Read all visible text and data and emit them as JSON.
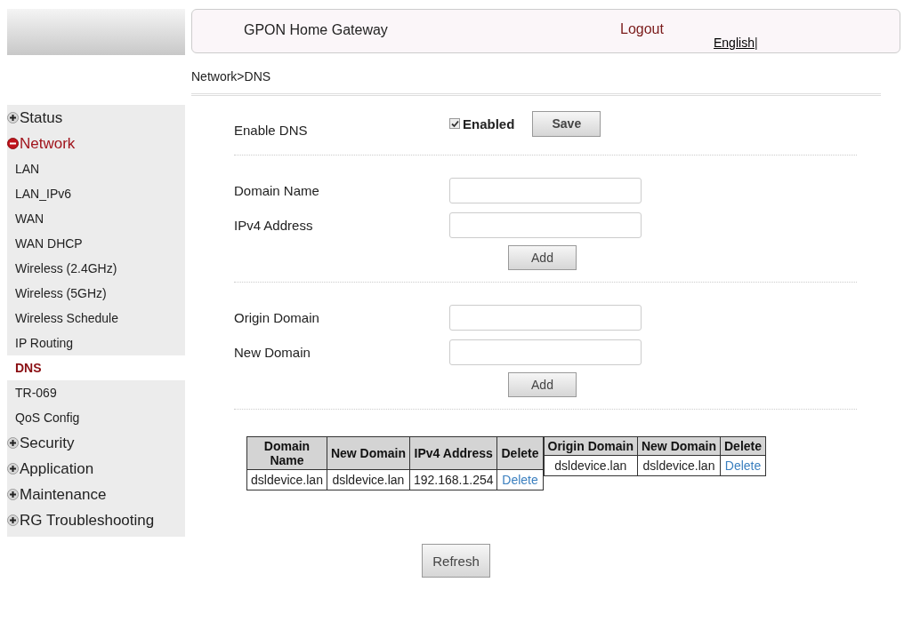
{
  "header": {
    "title": "GPON Home Gateway",
    "logout": "Logout",
    "language": "English",
    "separator": "|"
  },
  "breadcrumb": "Network>DNS",
  "sidebar": {
    "items": [
      {
        "label": "Status",
        "expanded": false
      },
      {
        "label": "Network",
        "expanded": true,
        "children": [
          {
            "label": "LAN",
            "selected": false
          },
          {
            "label": "LAN_IPv6",
            "selected": false
          },
          {
            "label": "WAN",
            "selected": false
          },
          {
            "label": "WAN DHCP",
            "selected": false
          },
          {
            "label": "Wireless (2.4GHz)",
            "selected": false
          },
          {
            "label": "Wireless (5GHz)",
            "selected": false
          },
          {
            "label": "Wireless Schedule",
            "selected": false
          },
          {
            "label": "IP Routing",
            "selected": false
          },
          {
            "label": "DNS",
            "selected": true
          },
          {
            "label": "TR-069",
            "selected": false
          },
          {
            "label": "QoS Config",
            "selected": false
          }
        ]
      },
      {
        "label": "Security",
        "expanded": false
      },
      {
        "label": "Application",
        "expanded": false
      },
      {
        "label": "Maintenance",
        "expanded": false
      },
      {
        "label": "RG Troubleshooting",
        "expanded": false
      }
    ]
  },
  "enable": {
    "label": "Enable DNS",
    "checkbox_label": "Enabled",
    "checked": true,
    "button": "Save"
  },
  "host_form": {
    "fields": [
      {
        "label": "Domain Name"
      },
      {
        "label": "IPv4 Address"
      }
    ],
    "button": "Add"
  },
  "alias_form": {
    "fields": [
      {
        "label": "Origin Domain"
      },
      {
        "label": "New Domain"
      }
    ],
    "button": "Add"
  },
  "host_table": {
    "columns": [
      "Domain Name",
      "New Domain",
      "IPv4 Address",
      "Delete"
    ],
    "rows": [
      [
        "dsldevice.lan",
        "dsldevice.lan",
        "192.168.1.254",
        "Delete"
      ]
    ]
  },
  "alias_table": {
    "columns": [
      "Origin Domain",
      "New Domain",
      "Delete"
    ],
    "rows": [
      [
        "dsldevice.lan",
        "dsldevice.lan",
        "Delete"
      ]
    ]
  },
  "refresh_button": "Refresh"
}
